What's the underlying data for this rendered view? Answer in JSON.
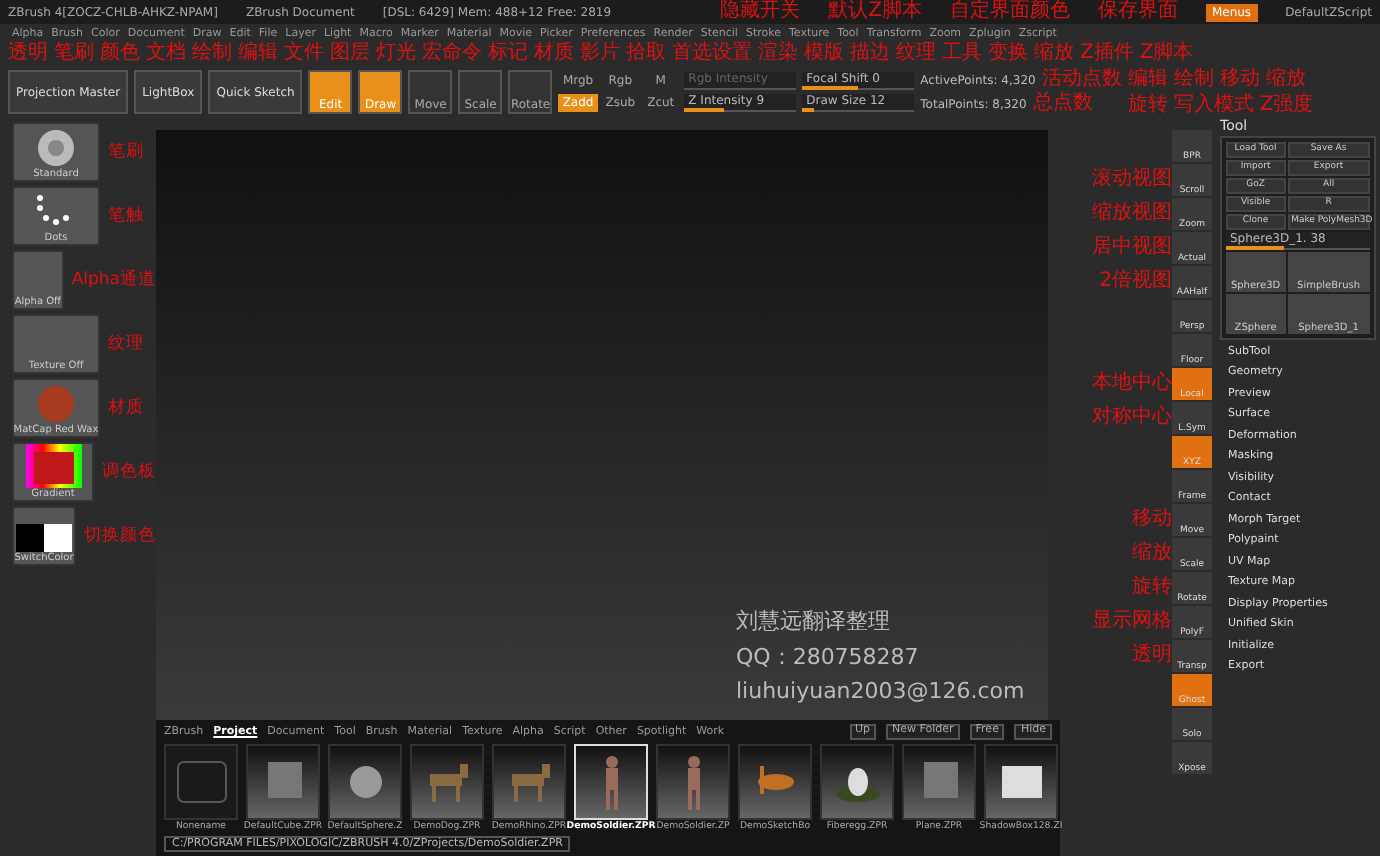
{
  "title_bar": {
    "texts": [
      "ZBrush 4[ZOCZ-CHLB-AHKZ-NPAM]",
      "ZBrush Document",
      "[DSL: 6429]  Mem: 488+12  Free: 2819"
    ],
    "menus_button": {
      "label": "Menus",
      "on": true
    },
    "script": "DefaultZScript"
  },
  "menu_bar": [
    {
      "label": "Alpha",
      "note": "透明"
    },
    {
      "label": "Brush",
      "note": "笔刷"
    },
    {
      "label": "Color",
      "note": "颜色"
    },
    {
      "label": "Document",
      "note": "文档"
    },
    {
      "label": "Draw",
      "note": "绘制"
    },
    {
      "label": "Edit",
      "note": "编辑"
    },
    {
      "label": "File",
      "note": "文件"
    },
    {
      "label": "Layer",
      "note": "图层"
    },
    {
      "label": "Light",
      "note": "灯光"
    },
    {
      "label": "Macro",
      "note": "宏命令"
    },
    {
      "label": "Marker",
      "note": "标记"
    },
    {
      "label": "Material",
      "note": "材质"
    },
    {
      "label": "Movie",
      "note": "影片"
    },
    {
      "label": "Picker",
      "note": "拾取"
    },
    {
      "label": "Preferences",
      "note": "首选设置"
    },
    {
      "label": "Render",
      "note": "渲染"
    },
    {
      "label": "Stencil",
      "note": "模版"
    },
    {
      "label": "Stroke",
      "note": "描边"
    },
    {
      "label": "Texture",
      "note": "纹理"
    },
    {
      "label": "Tool",
      "note": "工具"
    },
    {
      "label": "Transform",
      "note": "变换"
    },
    {
      "label": "Zoom",
      "note": "缩放"
    },
    {
      "label": "Zplugin",
      "note": "Z插件"
    },
    {
      "label": "Zscript",
      "note": "Z脚本"
    }
  ],
  "top_notes": [
    "隐藏开关",
    "默认Z脚本",
    "自定界面颜色",
    "保存界面"
  ],
  "toolbar": {
    "buttons": [
      {
        "label": "Projection Master",
        "kind": "wide",
        "on": false
      },
      {
        "label": "LightBox",
        "kind": "wide",
        "on": false
      },
      {
        "label": "Quick Sketch",
        "kind": "wide",
        "on": false
      },
      {
        "label": "Edit",
        "kind": "mode",
        "on": true
      },
      {
        "label": "Draw",
        "kind": "mode",
        "on": true
      },
      {
        "label": "Move",
        "kind": "mode",
        "on": false
      },
      {
        "label": "Scale",
        "kind": "mode",
        "on": false
      },
      {
        "label": "Rotate",
        "kind": "mode",
        "on": false
      }
    ],
    "notes": [
      "编辑",
      "绘制",
      "移动",
      "缩放",
      "旋转",
      "写入模式",
      "Z强度"
    ],
    "toggles": [
      {
        "label": "Mrgb",
        "on": false
      },
      {
        "label": "Rgb",
        "on": false
      },
      {
        "label": "M",
        "on": false
      },
      {
        "label": "Zadd",
        "on": true
      },
      {
        "label": "Zsub",
        "on": false
      },
      {
        "label": "Zcut",
        "on": false
      }
    ],
    "sliders": [
      {
        "label": "Rgb Intensity",
        "disabled": true
      },
      {
        "label": "Z Intensity 9",
        "level": 0.36,
        "disabled": false
      },
      {
        "label": "Focal Shift 0",
        "level": 0.5
      },
      {
        "label": "Draw Size 12",
        "level": 0.1
      }
    ],
    "stats": [
      {
        "text": "ActivePoints: 4,320",
        "note": "活动点数"
      },
      {
        "text": "TotalPoints: 8,320",
        "note": "总点数"
      }
    ]
  },
  "left_shelf": [
    {
      "label": "Standard",
      "note": "笔刷",
      "kind": "brush"
    },
    {
      "label": "Dots",
      "note": "笔触",
      "kind": "dots"
    },
    {
      "label": "Alpha Off",
      "note": "Alpha通道",
      "kind": "flat"
    },
    {
      "label": "Texture Off",
      "note": "纹理",
      "kind": "flat"
    },
    {
      "label": "MatCap Red Wax",
      "note": "材质",
      "kind": "sphere"
    },
    {
      "label": "Gradient",
      "note": "调色板",
      "kind": "palette"
    },
    {
      "label": "SwitchColor",
      "note": "切换颜色",
      "kind": "swatch"
    }
  ],
  "canvas_credit": [
    "刘慧远翻译整理",
    "QQ：280758287",
    "liuhuiyuan2003@126.com"
  ],
  "right_shelf": [
    {
      "label": "BPR",
      "active": false
    },
    {
      "label": "Scroll",
      "note": "滚动视图",
      "active": false
    },
    {
      "label": "Zoom",
      "note": "缩放视图",
      "active": false
    },
    {
      "label": "Actual",
      "note": "居中视图",
      "active": false
    },
    {
      "label": "AAHalf",
      "note": "2倍视图",
      "active": false
    },
    {
      "label": "Persp",
      "active": false
    },
    {
      "label": "Floor",
      "active": false
    },
    {
      "label": "Local",
      "note": "本地中心",
      "active": true
    },
    {
      "label": "L.Sym",
      "note": "对称中心",
      "active": false
    },
    {
      "label": "XYZ",
      "active": true
    },
    {
      "label": "Frame",
      "active": false
    },
    {
      "label": "Move",
      "note": "移动",
      "active": false
    },
    {
      "label": "Scale",
      "note": "缩放",
      "active": false
    },
    {
      "label": "Rotate",
      "note": "旋转",
      "active": false
    },
    {
      "label": "PolyF",
      "note": "显示网格",
      "active": false
    },
    {
      "label": "Transp",
      "note": "透明",
      "active": false
    },
    {
      "label": "Ghost",
      "active": true
    },
    {
      "label": "Solo",
      "active": false
    },
    {
      "label": "Xpose",
      "active": false
    }
  ],
  "tool_panel": {
    "title": "Tool",
    "buttons": [
      "Load Tool",
      "Save As",
      "Import",
      "Export",
      "GoZ",
      "All",
      "Visible",
      "R",
      "Clone",
      "Make PolyMesh3D"
    ],
    "slider": {
      "label": "Sphere3D_1. 38",
      "level": 0.4
    },
    "thumbs": [
      "Sphere3D",
      "SimpleBrush",
      "ZSphere",
      "Sphere3D_1"
    ],
    "items": [
      "SubTool",
      "Geometry",
      "Preview",
      "Surface",
      "Deformation",
      "Masking",
      "Visibility",
      "Contact",
      "Morph Target",
      "Polypaint",
      "UV Map",
      "Texture Map",
      "Display Properties",
      "Unified Skin",
      "Initialize",
      "Export"
    ]
  },
  "lightbox": {
    "tabs": [
      {
        "label": "ZBrush",
        "selected": false
      },
      {
        "label": "Project",
        "selected": true
      },
      {
        "label": "Document",
        "selected": false
      },
      {
        "label": "Tool",
        "selected": false
      },
      {
        "label": "Brush",
        "selected": false
      },
      {
        "label": "Material",
        "selected": false
      },
      {
        "label": "Texture",
        "selected": false
      },
      {
        "label": "Alpha",
        "selected": false
      },
      {
        "label": "Script",
        "selected": false
      },
      {
        "label": "Other",
        "selected": false
      },
      {
        "label": "Spotlight",
        "selected": false
      },
      {
        "label": "Work",
        "selected": false
      }
    ],
    "buttons": [
      "Up",
      "New Folder",
      "Free",
      "Hide"
    ],
    "files": [
      {
        "name": "Nonename",
        "kind": "folder",
        "selected": false
      },
      {
        "name": "DefaultCube.ZPR",
        "kind": "cube",
        "selected": false
      },
      {
        "name": "DefaultSphere.Z",
        "kind": "sphere",
        "selected": false
      },
      {
        "name": "DemoDog.ZPR",
        "kind": "animal",
        "selected": false
      },
      {
        "name": "DemoRhino.ZPR",
        "kind": "animal",
        "selected": false
      },
      {
        "name": "DemoSoldier.ZPR",
        "kind": "figure",
        "selected": true
      },
      {
        "name": "DemoSoldier.ZP",
        "kind": "figure",
        "selected": false
      },
      {
        "name": "DemoSketchBo",
        "kind": "insect",
        "selected": false
      },
      {
        "name": "Fiberegg.ZPR",
        "kind": "egg",
        "selected": false
      },
      {
        "name": "Plane.ZPR",
        "kind": "cube",
        "selected": false
      },
      {
        "name": "ShadowBox128.ZI",
        "kind": "box",
        "selected": false
      }
    ],
    "path": "C:/PROGRAM FILES/PIXOLOGIC/ZBRUSH 4.0/ZProjects/DemoSoldier.ZPR"
  }
}
